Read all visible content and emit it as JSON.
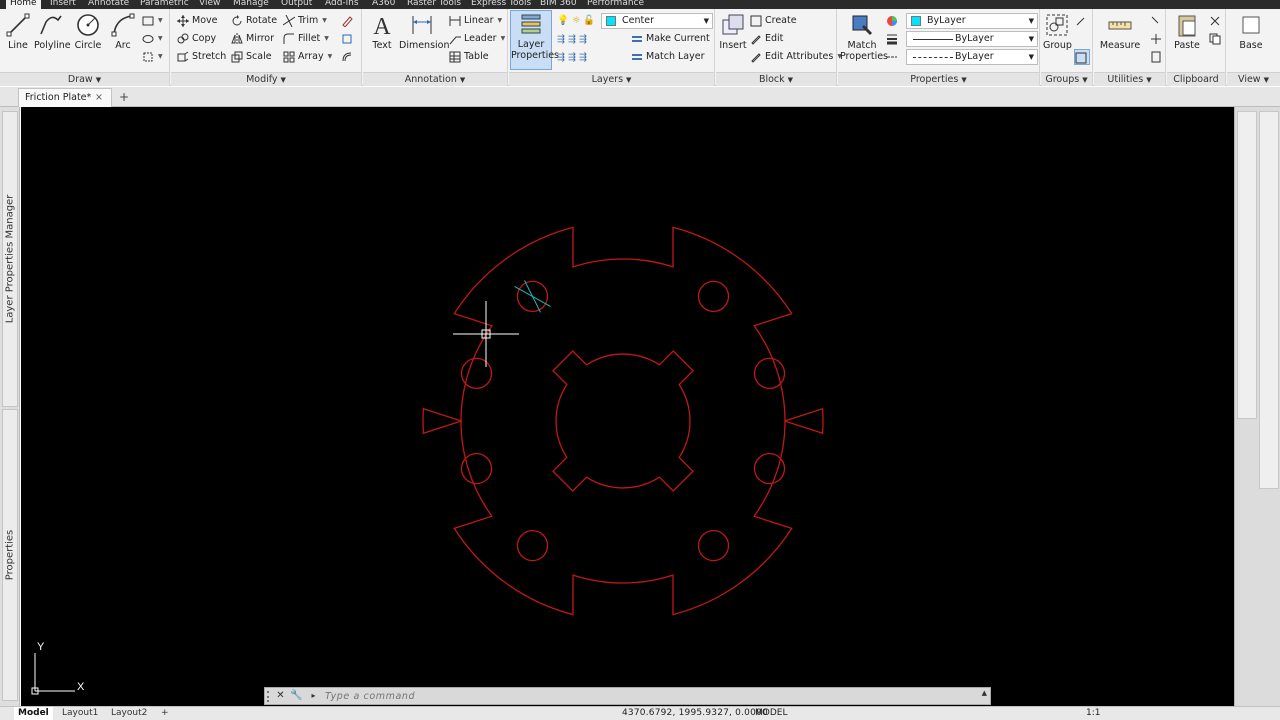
{
  "ribbon_tabs": [
    "Home",
    "Insert",
    "Annotate",
    "Parametric",
    "View",
    "Manage",
    "Output",
    "Add-ins",
    "A360",
    "Raster Tools",
    "Express Tools",
    "BIM 360",
    "Performance"
  ],
  "draw": {
    "title": "Draw",
    "line": "Line",
    "polyline": "Polyline",
    "circle": "Circle",
    "arc": "Arc"
  },
  "modify": {
    "title": "Modify",
    "move": "Move",
    "rotate": "Rotate",
    "trim": "Trim",
    "copy": "Copy",
    "mirror": "Mirror",
    "fillet": "Fillet",
    "stretch": "Stretch",
    "scale": "Scale",
    "array": "Array"
  },
  "annotation": {
    "title": "Annotation",
    "text": "Text",
    "dimension": "Dimension",
    "linear": "Linear",
    "leader": "Leader",
    "table": "Table"
  },
  "layers": {
    "title": "Layers",
    "layer_properties": "Layer Properties",
    "current_layer": "Center",
    "make_current": "Make Current",
    "match_layer": "Match Layer"
  },
  "block": {
    "title": "Block",
    "insert": "Insert",
    "create": "Create",
    "edit": "Edit",
    "edit_attributes": "Edit Attributes"
  },
  "properties": {
    "title": "Properties",
    "match_properties": "Match Properties",
    "color": "ByLayer",
    "lineweight": "ByLayer",
    "linetype": "ByLayer"
  },
  "groups": {
    "title": "Groups",
    "group": "Group"
  },
  "utilities": {
    "title": "Utilities",
    "measure": "Measure"
  },
  "clipboard": {
    "title": "Clipboard",
    "paste": "Paste"
  },
  "view": {
    "title": "View",
    "base": "Base"
  },
  "file_tab": {
    "name": "Friction Plate*",
    "close": "×",
    "new": "+"
  },
  "palettes": {
    "layer_manager": "Layer Properties Manager",
    "properties": "Properties"
  },
  "ucs": {
    "x": "X",
    "y": "Y"
  },
  "command_line": {
    "placeholder": "Type a command"
  },
  "status": {
    "layouts": [
      "Model",
      "Layout1",
      "Layout2"
    ],
    "add_layout": "+",
    "coords": "4370.6792, 1995.9327, 0.0000",
    "mode": "MODEL",
    "scale": "1:1"
  },
  "colors": {
    "canvas": "#000000",
    "geometry": "#c01818",
    "crosshair": "#ffffff",
    "center_marks": "#20b8b8",
    "layer_swatch": "#00e5ff"
  },
  "icons": [
    "line-icon",
    "polyline-icon",
    "circle-icon",
    "arc-icon",
    "move-icon",
    "rotate-icon",
    "trim-icon",
    "copy-icon",
    "mirror-icon",
    "fillet-icon",
    "stretch-icon",
    "scale-icon",
    "array-icon",
    "text-icon",
    "dimension-icon",
    "layer-properties-icon",
    "insert-block-icon",
    "match-properties-icon",
    "group-icon",
    "measure-icon",
    "paste-icon",
    "base-icon"
  ]
}
